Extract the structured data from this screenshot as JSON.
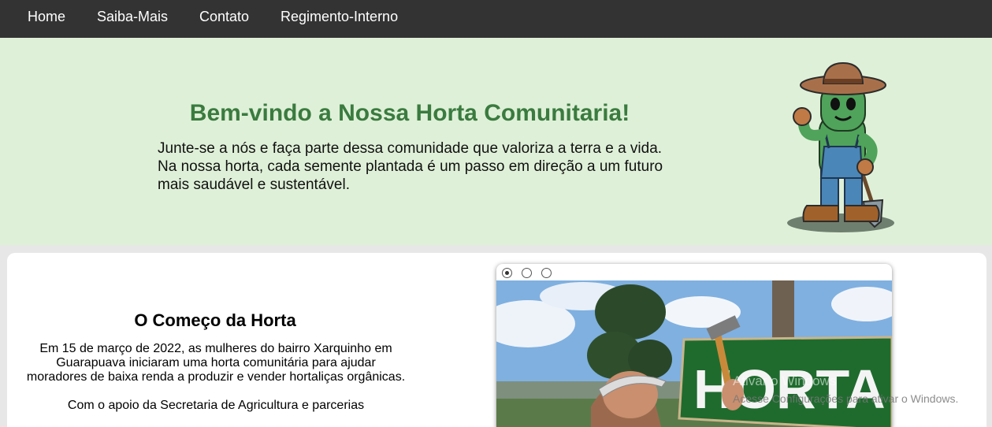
{
  "nav": {
    "items": [
      {
        "label": "Home"
      },
      {
        "label": "Saiba-Mais"
      },
      {
        "label": "Contato"
      },
      {
        "label": "Regimento-Interno"
      }
    ]
  },
  "hero": {
    "title": "Bem-vindo a Nossa Horta Comunitaria!",
    "text": "Junte-se a nós e faça parte dessa comunidade que valoriza a terra e a vida. Na nossa horta, cada semente plantada é um passo em direção a um futuro mais saudável e sustentável.",
    "mascot_icon": "cactus-farmer-mascot"
  },
  "section": {
    "title": "O Começo da Horta",
    "paragraphs": [
      "Em 15 de março de 2022, as mulheres do bairro Xarquinho em Guarapuava iniciaram uma horta comunitária para ajudar moradores de baixa renda a produzir e vender hortaliças orgânicas.",
      "Com o apoio da Secretaria de Agricultura e parcerias"
    ]
  },
  "slider": {
    "selected_index": 0,
    "slide_count": 3,
    "sign_text": "HORTA"
  },
  "watermark": {
    "title": "Ativar o Windows",
    "subtitle": "Acesse Configurações para ativar o Windows."
  },
  "colors": {
    "navbar": "#333333",
    "hero_bg": "#dff0d8",
    "hero_title": "#3a7b3f",
    "page_bg": "#e7e7e7"
  }
}
